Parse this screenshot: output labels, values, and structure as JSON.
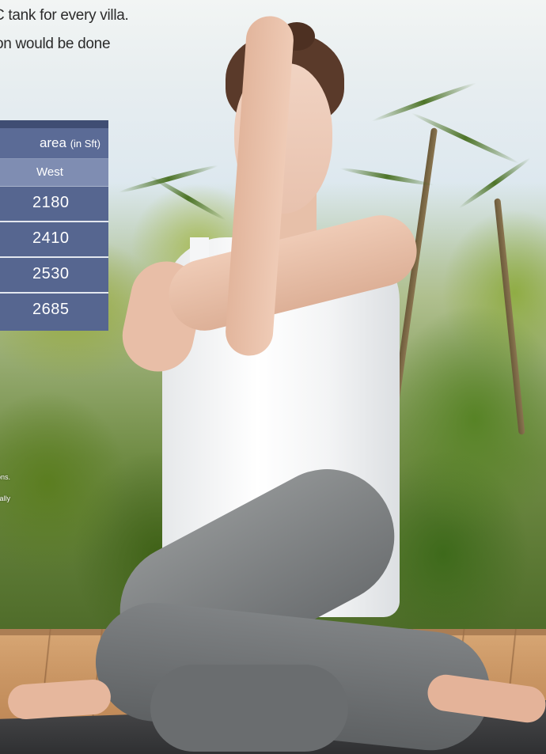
{
  "intro": {
    "line1": "C tank for every villa.",
    "line2": "on would be done"
  },
  "area_table": {
    "title": "area",
    "unit": "(in Sft)",
    "column_header": "West",
    "rows": [
      "2180",
      "2410",
      "2530",
      "2685"
    ]
  },
  "notes": {
    "note1": "ons.",
    "note2": "tally"
  },
  "colors": {
    "table_header": "#5b6b96",
    "table_row": "#566690",
    "column_header": "#7f8db2"
  }
}
